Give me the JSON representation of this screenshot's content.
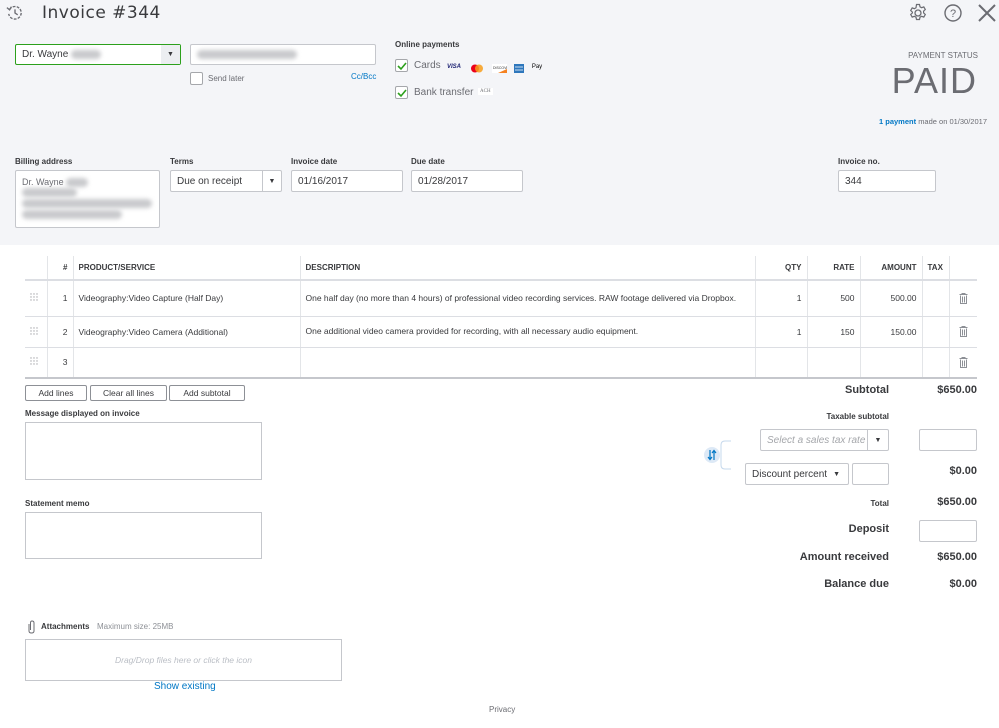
{
  "header": {
    "title": "Invoice #344",
    "icons": [
      "history-icon",
      "gear-icon",
      "help-icon",
      "close-icon"
    ]
  },
  "customer": {
    "name": "Dr. Wayne",
    "email_placeholder": "",
    "send_later_label": "Send later",
    "send_later_checked": false,
    "cc_bcc_label": "Cc/Bcc"
  },
  "online_payments": {
    "title": "Online payments",
    "cards_label": "Cards",
    "cards_checked": true,
    "card_brands": [
      "VISA",
      "Mastercard",
      "Discover",
      "American Express",
      "Apple Pay"
    ],
    "bank_label": "Bank transfer",
    "bank_checked": true,
    "bank_badge": "ACH"
  },
  "payment_status": {
    "label": "PAYMENT STATUS",
    "value": "PAID",
    "payment_link": "1 payment",
    "payment_text": "made on 01/30/2017"
  },
  "fields": {
    "billing_label": "Billing address",
    "billing_name": "Dr. Wayne",
    "terms_label": "Terms",
    "terms_value": "Due on receipt",
    "invoice_date_label": "Invoice date",
    "invoice_date": "01/16/2017",
    "due_date_label": "Due date",
    "due_date": "01/28/2017",
    "invoice_no_label": "Invoice no.",
    "invoice_no": "344"
  },
  "table": {
    "columns": [
      "#",
      "PRODUCT/SERVICE",
      "DESCRIPTION",
      "QTY",
      "RATE",
      "AMOUNT",
      "TAX"
    ],
    "rows": [
      {
        "num": "1",
        "product": "Videography:Video Capture (Half Day)",
        "description": "One half day (no more than 4 hours) of professional video recording services. RAW footage delivered via Dropbox.",
        "qty": "1",
        "rate": "500",
        "amount": "500.00",
        "tax": ""
      },
      {
        "num": "2",
        "product": "Videography:Video Camera (Additional)",
        "description": "One additional video camera provided for recording, with all necessary audio equipment.",
        "qty": "1",
        "rate": "150",
        "amount": "150.00",
        "tax": ""
      },
      {
        "num": "3",
        "product": "",
        "description": "",
        "qty": "",
        "rate": "",
        "amount": "",
        "tax": ""
      }
    ]
  },
  "buttons": {
    "add_lines": "Add lines",
    "clear_all_lines": "Clear all lines",
    "add_subtotal": "Add subtotal"
  },
  "message": {
    "label": "Message displayed on invoice",
    "value": ""
  },
  "memo": {
    "label": "Statement memo",
    "value": ""
  },
  "totals": {
    "subtotal_label": "Subtotal",
    "subtotal": "$650.00",
    "taxable_subtotal_label": "Taxable subtotal",
    "tax_rate_placeholder": "Select a sales tax rate",
    "discount_type": "Discount percent",
    "discount_amount": "$0.00",
    "total_label": "Total",
    "total": "$650.00",
    "deposit_label": "Deposit",
    "amount_received_label": "Amount received",
    "amount_received": "$650.00",
    "balance_due_label": "Balance due",
    "balance_due": "$0.00"
  },
  "attachments": {
    "label": "Attachments",
    "max_size": "Maximum size: 25MB",
    "drop_text": "Drag/Drop files here or click the icon",
    "show_existing": "Show existing"
  },
  "footer": {
    "privacy": "Privacy"
  },
  "colors": {
    "accent_green": "#2ca01c",
    "link_blue": "#0077c5",
    "header_bg": "#f4f5f8"
  }
}
